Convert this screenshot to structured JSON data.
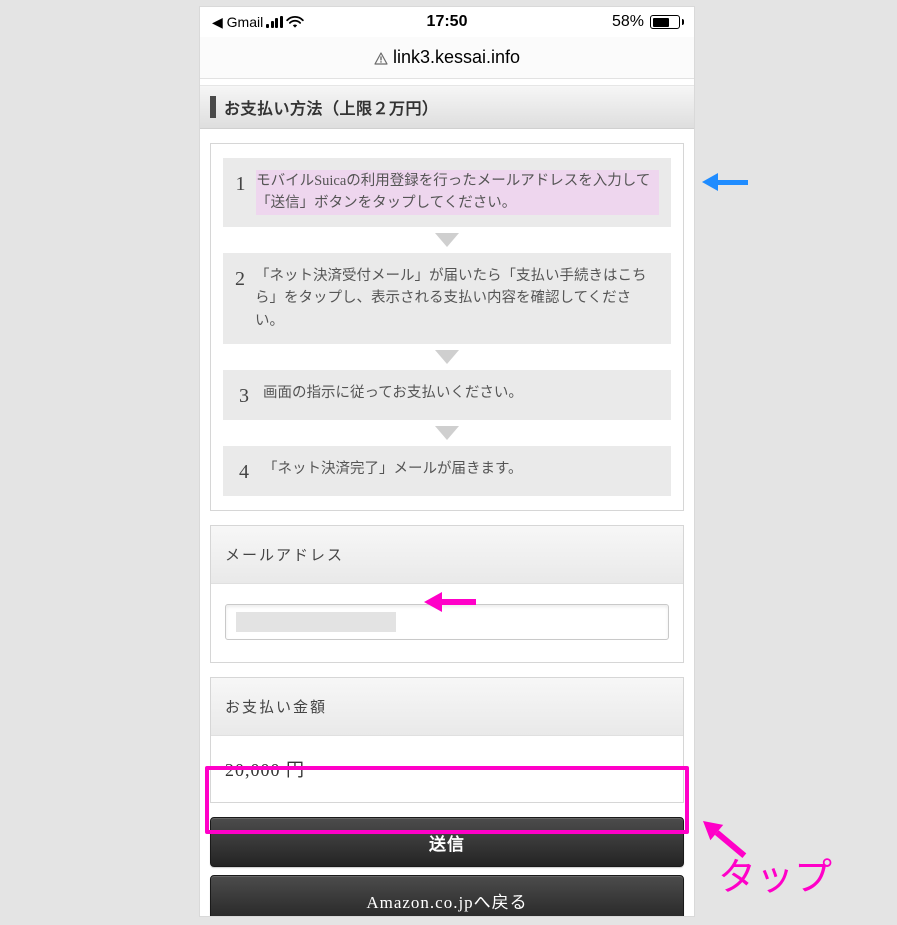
{
  "statusbar": {
    "back_app": "◀ Gmail",
    "time": "17:50",
    "battery_pct_label": "58%",
    "battery_fill_pct": 58
  },
  "addressbar": {
    "domain": "link3.kessai.info"
  },
  "payment_method": {
    "header": "お支払い方法（上限２万円）",
    "steps": [
      {
        "num": "1",
        "text": "モバイルSuicaの利用登録を行ったメールアドレスを入力して「送信」ボタンをタップしてください。",
        "highlighted": true
      },
      {
        "num": "2",
        "text": "「ネット決済受付メール」が届いたら「支払い手続きはこちら」をタップし、表示される支払い内容を確認してください。",
        "highlighted": false
      },
      {
        "num": "3",
        "text": "画面の指示に従ってお支払いください。",
        "highlighted": false
      },
      {
        "num": "4",
        "text": "「ネット決済完了」メールが届きます。",
        "highlighted": false
      }
    ]
  },
  "email": {
    "label": "メールアドレス",
    "value": ""
  },
  "amount": {
    "label": "お支払い金額",
    "value": "20,000 円"
  },
  "buttons": {
    "submit": "送信",
    "back": "Amazon.co.jpへ戻る"
  },
  "annotations": {
    "tap_label": "タップ"
  },
  "colors": {
    "annotation_magenta": "#ff00c8",
    "annotation_blue": "#1f8cff"
  }
}
